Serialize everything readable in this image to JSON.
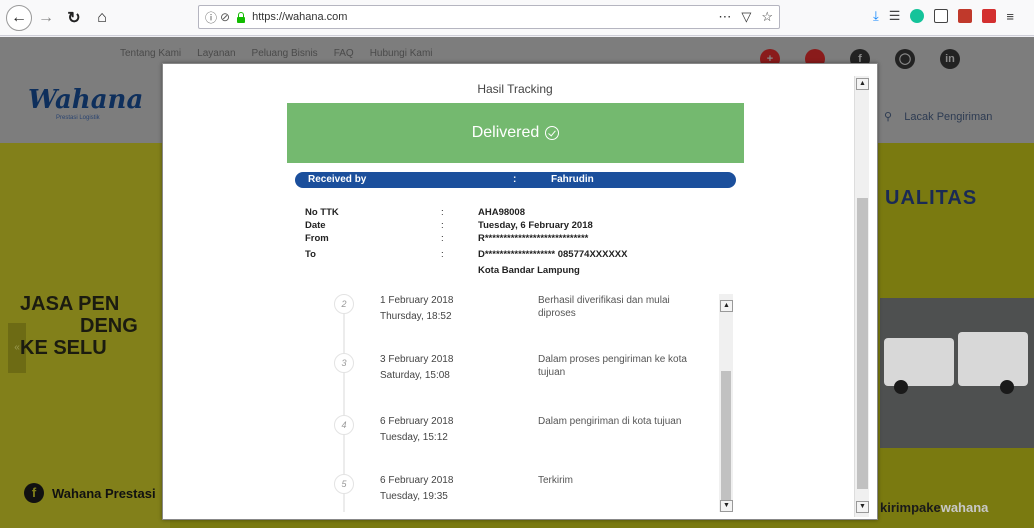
{
  "browser": {
    "url": "https://wahana.com",
    "page_actions": "⋯",
    "pocket_icon": "▽",
    "bookmark_icon": "☆"
  },
  "site": {
    "top_links": [
      "Tentang Kami",
      "Layanan",
      "Peluang Bisnis",
      "FAQ",
      "Hubungi Kami"
    ],
    "logo": "Wahana",
    "logo_sub": "Prestasi Logistik",
    "lacak": "Lacak Pengiriman",
    "hero_left_lines": [
      "JASA PEN",
      "DENG",
      "KE SELU"
    ],
    "hero_right": "UALITAS",
    "footer_left": "Wahana Prestasi",
    "footer_right_a": "kirimpake",
    "footer_right_b": "wahana"
  },
  "modal": {
    "title": "Hasil Tracking",
    "status": "Delivered",
    "received_label": "Received by",
    "received_colon": ":",
    "received_value": "Fahrudin",
    "info": [
      {
        "label": "No TTK",
        "colon": ":",
        "value": "AHA98008"
      },
      {
        "label": "Date",
        "colon": ":",
        "value": "Tuesday, 6 February 2018"
      },
      {
        "label": "From",
        "colon": ":",
        "value": "R****************************"
      },
      {
        "label": "To",
        "colon": ":",
        "value": "D******************* 085774XXXXXX"
      },
      {
        "label": "",
        "colon": "",
        "value": "Kota Bandar Lampung"
      }
    ],
    "history": [
      {
        "step": "2",
        "date": "1 February 2018",
        "time": "Thursday, 18:52",
        "desc": "Berhasil diverifikasi dan mulai diproses"
      },
      {
        "step": "3",
        "date": "3 February 2018",
        "time": "Saturday, 15:08",
        "desc": "Dalam proses pengiriman ke kota tujuan"
      },
      {
        "step": "4",
        "date": "6 February 2018",
        "time": "Tuesday, 15:12",
        "desc": "Dalam pengiriman di kota tujuan"
      },
      {
        "step": "5",
        "date": "6 February 2018",
        "time": "Tuesday, 19:35",
        "desc": "Terkirim"
      }
    ]
  }
}
